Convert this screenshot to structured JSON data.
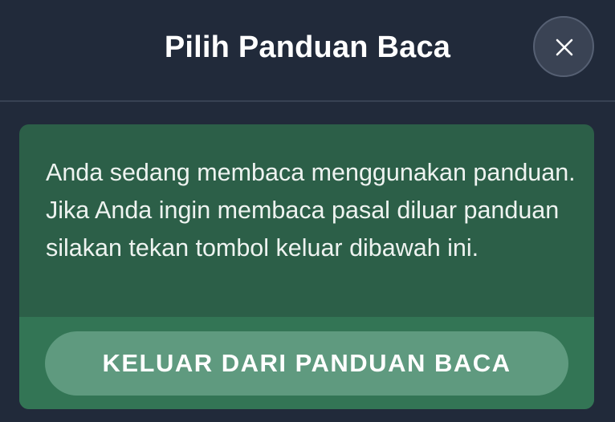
{
  "dialog": {
    "title": "Pilih Panduan Baca",
    "close_icon": "close-icon"
  },
  "notice": {
    "message": "Anda sedang membaca menggunakan panduan. Jika Anda ingin membaca pasal diluar panduan silakan tekan tombol keluar dibawah ini.",
    "exit_button_label": "KELUAR DARI PANDUAN BACA"
  },
  "colors": {
    "background": "#212a3a",
    "card": "#2c5f48",
    "card_footer": "#337555",
    "exit_button": "#5f9a7f"
  }
}
